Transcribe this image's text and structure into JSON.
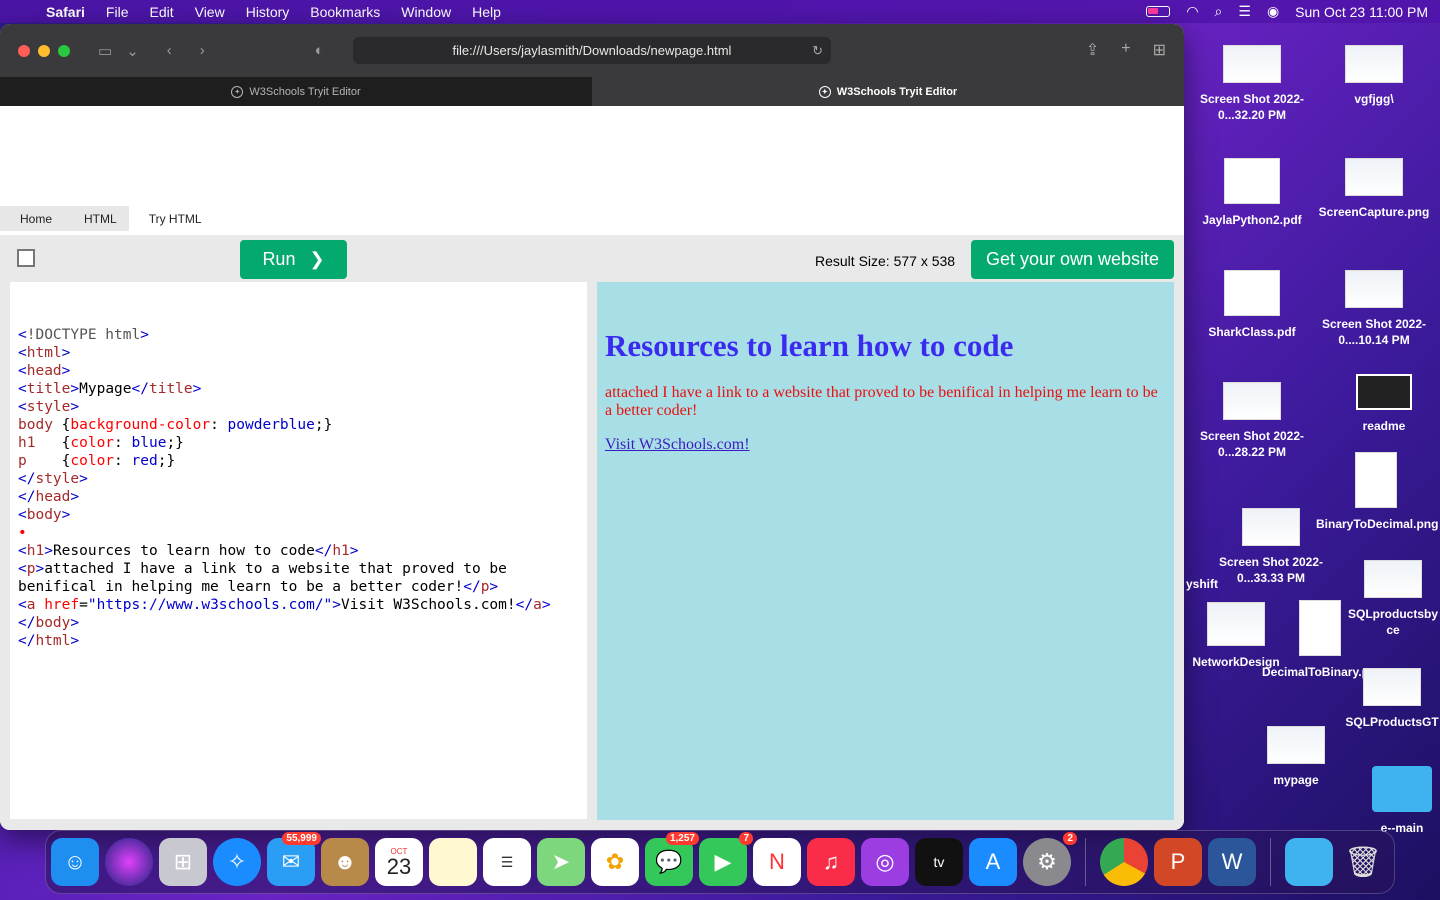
{
  "menubar": {
    "items": [
      "Safari",
      "File",
      "Edit",
      "View",
      "History",
      "Bookmarks",
      "Window",
      "Help"
    ],
    "datetime": "Sun Oct 23  11:00 PM"
  },
  "browser": {
    "url": "file:///Users/jaylasmith/Downloads/newpage.html",
    "tabs": [
      "W3Schools Tryit Editor",
      "W3Schools Tryit Editor"
    ]
  },
  "page": {
    "breadcrumbs": [
      "Home",
      "HTML",
      "Try HTML"
    ],
    "run_label": "Run",
    "result_size": "Result Size: 577 x 538",
    "get_website_label": "Get your own website"
  },
  "result": {
    "heading": "Resources to learn how to code",
    "paragraph": "attached I have a link to a website that proved to be benifical in helping me learn to be a better coder!",
    "link": "Visit W3Schools.com!"
  },
  "desktop": {
    "icons": [
      "Screen Shot 2022-0...32.20 PM",
      "vgfjgg\\",
      "JaylaPython2.pdf",
      "ScreenCapture.png",
      "SharkClass.pdf",
      "Screen Shot 2022-0....10.14 PM",
      "Screen Shot 2022-0...28.22 PM",
      "readme",
      "BinaryToDecimal.png",
      "Screen Shot 2022-0...33.33 PM",
      "yshift",
      "SQLproductsby ce",
      "NetworkDesign",
      "DecimalToBinary.png",
      "SQLProductsGT",
      "mypage",
      "e--main"
    ]
  },
  "dock": {
    "badges": {
      "mail": "55,999",
      "calendar_month": "OCT",
      "calendar_day": "23",
      "messages": "1,257",
      "facetime": "7",
      "settings": "2"
    }
  }
}
